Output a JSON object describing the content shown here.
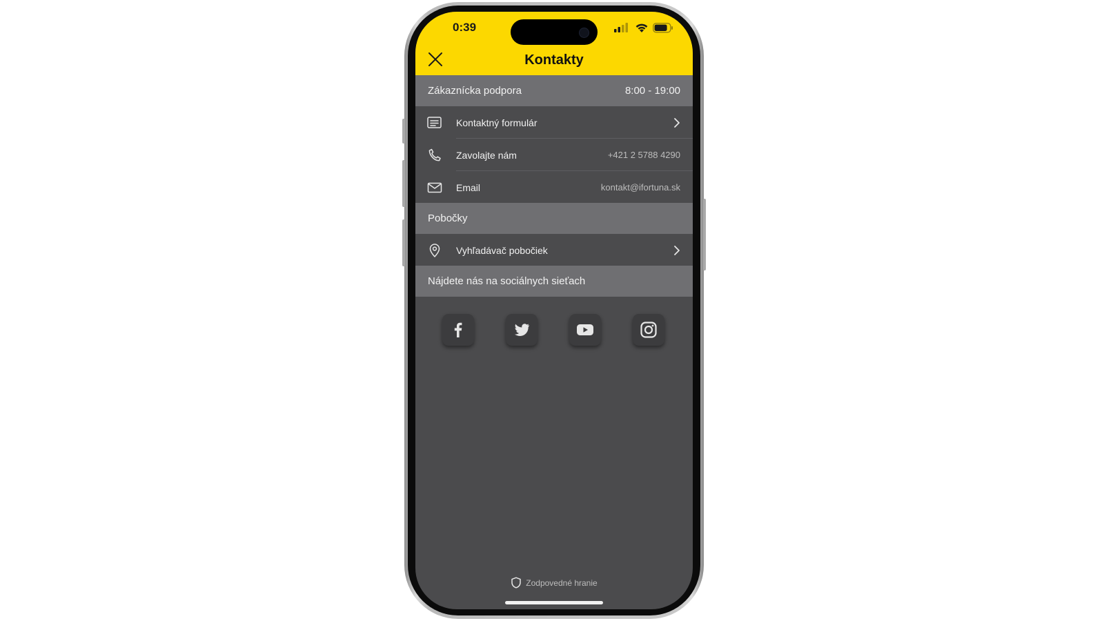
{
  "status_bar": {
    "time": "0:39"
  },
  "header": {
    "title": "Kontakty"
  },
  "sections": {
    "support": {
      "title": "Zákaznícka podpora",
      "hours": "8:00 - 19:00"
    },
    "branches": {
      "title": "Pobočky"
    },
    "social": {
      "title": "Nájdete nás na sociálnych sieťach"
    }
  },
  "support_rows": [
    {
      "label": "Kontaktný formulár",
      "icon": "form-icon"
    },
    {
      "label": "Zavolajte nám",
      "value": "+421 2 5788 4290",
      "icon": "phone-icon"
    },
    {
      "label": "Email",
      "value": "kontakt@ifortuna.sk",
      "icon": "mail-icon"
    }
  ],
  "branch_rows": [
    {
      "label": "Vyhľadávač pobočiek",
      "icon": "location-pin-icon"
    }
  ],
  "social_icons": [
    "facebook-icon",
    "twitter-icon",
    "youtube-icon",
    "instagram-icon"
  ],
  "footer": {
    "label": "Zodpovedné hranie"
  },
  "colors": {
    "accent": "#fcd800",
    "background": "#4b4b4d",
    "section": "#6f6f72"
  }
}
